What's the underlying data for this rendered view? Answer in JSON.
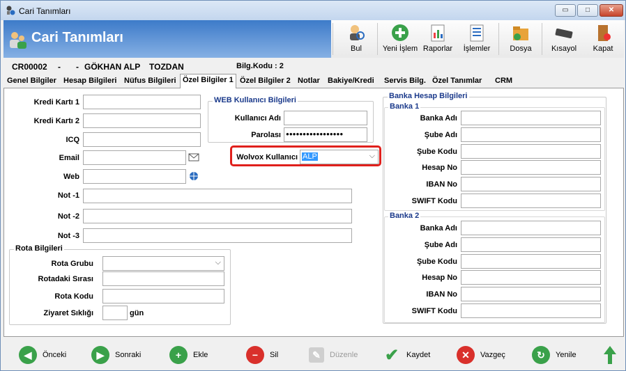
{
  "window": {
    "title": "Cari Tanımları",
    "min": "▭",
    "max": "□",
    "close": "✕"
  },
  "header": {
    "title": "Cari Tanımları"
  },
  "toolbar": {
    "bul": "Bul",
    "yeni_islem": "Yeni İşlem",
    "raporlar": "Raporlar",
    "islemler": "İşlemler",
    "dosya": "Dosya",
    "kisayol": "Kısayol",
    "kapat": "Kapat"
  },
  "info": {
    "code": "CR00002",
    "sep1": "-",
    "sep2": "-",
    "name": "GÖKHAN ALP",
    "surname": "TOZDAN",
    "bilg": "Bilg.Kodu : 2"
  },
  "tabs": [
    "Genel Bilgiler",
    "Hesap Bilgileri",
    "Nüfus Bilgileri",
    "Özel Bilgiler 1",
    "Özel Bilgiler 2",
    "Notlar",
    "Bakiye/Kredi",
    "Servis Bilg.",
    "Özel Tanımlar",
    "CRM"
  ],
  "left": {
    "kredi1": "Kredi Kartı 1",
    "kredi2": "Kredi Kartı 2",
    "icq": "ICQ",
    "email": "Email",
    "web": "Web",
    "not1": "Not -1",
    "not2": "Not -2",
    "not3": "Not -3"
  },
  "web": {
    "group": "WEB Kullanıcı Bilgileri",
    "kadi": "Kullanıcı Adı",
    "parola": "Parolası",
    "parola_value": "●●●●●●●●●●●●●●●●●"
  },
  "wolvox": {
    "label": "Wolvox Kullanıcı",
    "value": "ALP"
  },
  "rota": {
    "group": "Rota Bilgileri",
    "grubu": "Rota Grubu",
    "sira": "Rotadaki Sırası",
    "kodu": "Rota Kodu",
    "siklik": "Ziyaret Sıklığı",
    "gun": "gün"
  },
  "banka": {
    "group": "Banka Hesap Bilgileri",
    "b1": "Banka 1",
    "b2": "Banka 2",
    "adi": "Banka Adı",
    "sube": "Şube Adı",
    "subekod": "Şube Kodu",
    "hesap": "Hesap No",
    "iban": "IBAN No",
    "swift": "SWIFT Kodu"
  },
  "buttons": {
    "onceki": "Önceki",
    "sonraki": "Sonraki",
    "ekle": "Ekle",
    "sil": "Sil",
    "duzenle": "Düzenle",
    "kaydet": "Kaydet",
    "vazgec": "Vazgeç",
    "yenile": "Yenile"
  }
}
